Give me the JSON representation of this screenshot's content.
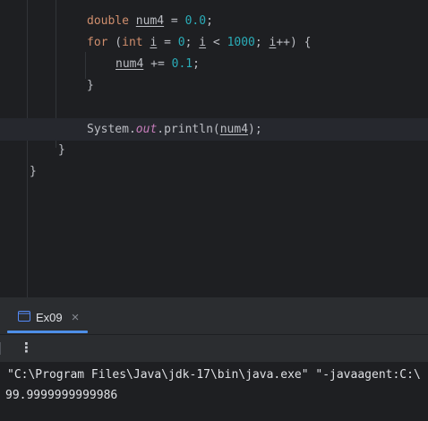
{
  "editor": {
    "line1": {
      "type": "double",
      "var": "num4",
      "op": " = ",
      "value": "0.0",
      "end": ";"
    },
    "line2": {
      "kw_for": "for",
      "open": " (",
      "type": "int",
      "var": "i",
      "eq": " = ",
      "zero": "0",
      "semi1": "; ",
      "var2": "i",
      "lt": " < ",
      "limit": "1000",
      "semi2": "; ",
      "var3": "i",
      "inc": "++) {"
    },
    "line3": {
      "var": "num4",
      "op": " += ",
      "value": "0.1",
      "end": ";"
    },
    "line4": {
      "text": "}"
    },
    "line6": {
      "cls": "System",
      "dot1": ".",
      "field": "out",
      "call": ".println(",
      "arg": "num4",
      "end": ");"
    },
    "line7": {
      "text": "}"
    },
    "line8": {
      "text": "}"
    }
  },
  "run_panel": {
    "tab_label": "Ex09",
    "close_glyph": "×",
    "menu_glyph": "⋮",
    "output_lines": [
      "\"C:\\Program Files\\Java\\jdk-17\\bin\\java.exe\" \"-javaagent:C:\\",
      "99.9999999999986"
    ]
  },
  "icons": [
    "console-icon",
    "close-icon",
    "more-options-icon"
  ],
  "colors": {
    "keyword": "#cf8e6d",
    "number": "#2aacb8",
    "field": "#c77dbb",
    "tab_accent": "#4e8fe8"
  }
}
